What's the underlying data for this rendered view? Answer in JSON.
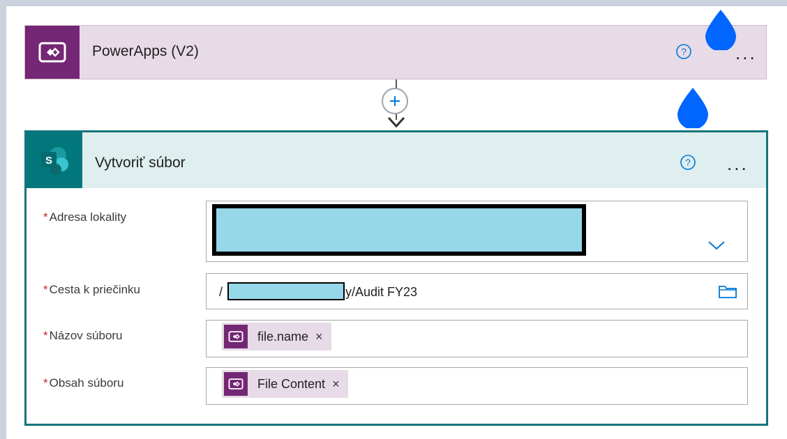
{
  "trigger": {
    "title": "PowerApps (V2)",
    "icon": "powerapps-icon",
    "help_icon": "?",
    "more_label": "..."
  },
  "connector": {
    "add_icon": "+"
  },
  "action": {
    "title": "Vytvoriť súbor",
    "icon": "sharepoint-icon",
    "help_icon": "?",
    "more_label": "...",
    "fields": {
      "site_address": {
        "label": "Adresa lokality",
        "required_mark": "*"
      },
      "folder_path": {
        "label": "Cesta k priečinku",
        "required_mark": "*",
        "value_prefix": "/",
        "value_suffix": "y/Audit FY23"
      },
      "file_name": {
        "label": "Názov súboru",
        "required_mark": "*",
        "token": "file.name",
        "remove": "×"
      },
      "file_content": {
        "label": "Obsah súboru",
        "required_mark": "*",
        "token": "File Content",
        "remove": "×"
      }
    }
  },
  "colors": {
    "powerapps_purple": "#742774",
    "trigger_bg": "#e8dbe8",
    "sharepoint_teal": "#03787c",
    "action_border": "#15757b",
    "action_header_bg": "#dfeeee",
    "help_blue": "#0078d4",
    "marker_blue": "#0066ff",
    "redaction_fill": "#96d8e8"
  }
}
